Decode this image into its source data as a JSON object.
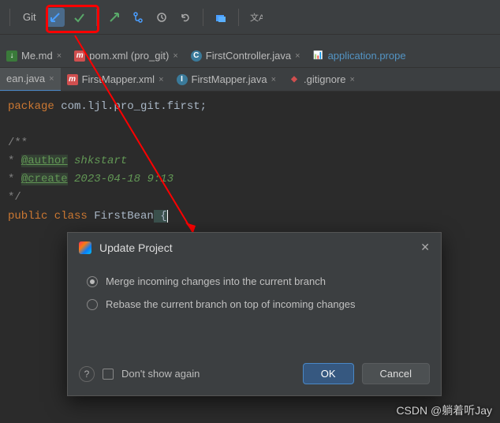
{
  "toolbar": {
    "git_label": "Git"
  },
  "tabs_row1": [
    {
      "icon": "md",
      "label": "Me.md"
    },
    {
      "icon": "m",
      "label": "pom.xml (pro_git)"
    },
    {
      "icon": "c",
      "label": "FirstController.java"
    },
    {
      "icon": "prop",
      "label": "application.prope"
    }
  ],
  "tabs_row2": [
    {
      "icon": "c",
      "label": "ean.java"
    },
    {
      "icon": "m",
      "label": "FirstMapper.xml"
    },
    {
      "icon": "j",
      "label": "FirstMapper.java"
    },
    {
      "icon": "git",
      "label": ".gitignore"
    }
  ],
  "code": {
    "line1_kw": "package",
    "line1_pkg": " com.ljl.pro_git.first;",
    "line3": "/**",
    "line4_star": " * ",
    "line4_tag": "@author",
    "line4_val": " shkstart",
    "line5_star": " * ",
    "line5_tag": "@create",
    "line5_val": " 2023-04-18 9:13",
    "line6": " */",
    "line7_kw": "public class ",
    "line7_cls": "FirstBean",
    "line7_brace": " {"
  },
  "dialog": {
    "title": "Update Project",
    "option1": "Merge incoming changes into the current branch",
    "option2": "Rebase the current branch on top of incoming changes",
    "dont_show": "Don't show again",
    "ok": "OK",
    "cancel": "Cancel"
  },
  "watermark": "CSDN @躺着听Jay"
}
